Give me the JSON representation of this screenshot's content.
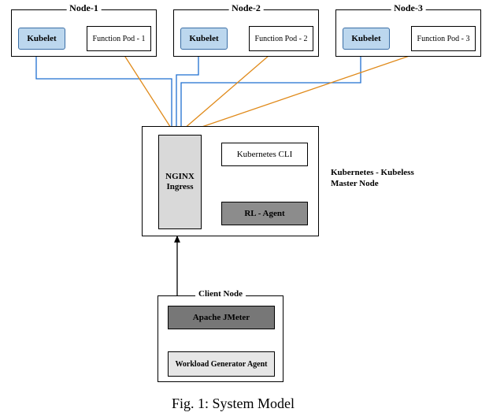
{
  "nodes": [
    {
      "title": "Node-1",
      "kubelet": "Kubelet",
      "pod": "Function Pod - 1"
    },
    {
      "title": "Node-2",
      "kubelet": "Kubelet",
      "pod": "Function Pod - 2"
    },
    {
      "title": "Node-3",
      "kubelet": "Kubelet",
      "pod": "Function Pod - 3"
    }
  ],
  "master": {
    "nginx": "NGINX\nIngress",
    "cli": "Kubernetes CLI",
    "rl": "RL - Agent",
    "label": "Kubernetes - Kubeless Master Node"
  },
  "client": {
    "title": "Client Node",
    "jmeter": "Apache JMeter",
    "wga": "Workload Generator Agent"
  },
  "caption": "Fig. 1: System Model"
}
